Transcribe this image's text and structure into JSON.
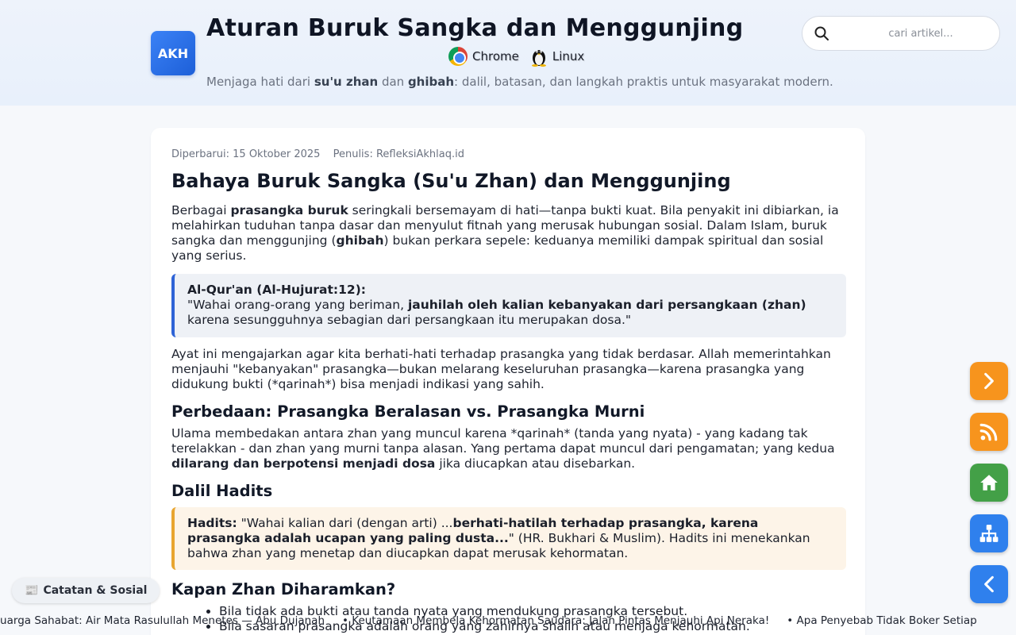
{
  "header": {
    "logo": "AKH",
    "title": "Aturan Buruk Sangka dan Menggunjing",
    "env": {
      "browser": "Chrome",
      "os": "Linux"
    },
    "tagline_parts": [
      "Menjaga hati dari ",
      "su'u zhan",
      " dan ",
      "ghibah",
      ": dalil, batasan, dan langkah praktis untuk masyarakat modern."
    ],
    "search_placeholder": "cari artikel..."
  },
  "article": {
    "updated": "Diperbarui: 15 Oktober 2025",
    "author": "Penulis: RefleksiAkhlaq.id",
    "title": "Bahaya Buruk Sangka (Su'u Zhan) dan Menggunjing",
    "intro_parts": [
      "Berbagai ",
      "prasangka buruk",
      " seringkali bersemayam di hati—tanpa bukti kuat. Bila penyakit ini dibiarkan, ia melahirkan tuduhan tanpa dasar dan menyulut fitnah yang merusak hubungan sosial. Dalam Islam, buruk sangka dan menggunjing (",
      "ghibah",
      ") bukan perkara sepele: keduanya memiliki dampak spiritual dan sosial yang serius."
    ],
    "quran": {
      "source": "Al-Qur'an (Al-Hujurat:12):",
      "text_a": "\"Wahai orang-orang yang beriman, ",
      "text_b": "jauhilah oleh kalian kebanyakan dari persangkaan (zhan)",
      "text_c": " karena sesungguhnya sebagian dari persangkaan itu merupakan dosa.\""
    },
    "paragraph2": "Ayat ini mengajarkan agar kita berhati-hati terhadap prasangka yang tidak berdasar. Allah memerintahkan menjauhi \"kebanyakan\" prasangka—bukan melarang keseluruhan prasangka—karena prasangka yang didukung bukti (*qarinah*) bisa menjadi indikasi yang sahih.",
    "h2_diff": "Perbedaan: Prasangka Beralasan vs. Prasangka Murni",
    "diff_a": "Ulama membedakan antara zhan yang muncul karena *qarinah* (tanda yang nyata) - yang kadang tak terelakkan - dan zhan yang murni tanpa alasan. Yang pertama dapat muncul dari pengamatan; yang kedua ",
    "diff_b": "dilarang dan berpotensi menjadi dosa",
    "diff_c": " jika diucapkan atau disebarkan.",
    "h2_hadith": "Dalil Hadits",
    "hadith": {
      "label": "Hadits:",
      "text_a": " \"Wahai kalian dari (dengan arti) ...",
      "text_b": "berhati-hatilah terhadap prasangka, karena prasangka adalah ucapan yang paling dusta...",
      "text_c": "\" (HR. Bukhari & Muslim). Hadits ini menekankan bahwa zhan yang menetap dan diucapkan dapat merusak kehormatan."
    },
    "h2_when": "Kapan Zhan Diharamkan?",
    "when_items": [
      "Bila tidak ada bukti atau tanda nyata yang mendukung prasangka tersebut.",
      "Bila sasaran prasangka adalah orang yang zahirnya shalih atau menjaga kehormatan."
    ]
  },
  "side_nav": {
    "colors": {
      "next": "#f7941d",
      "rss": "#f7941d",
      "home": "#43a047",
      "sitemap": "#2f80ed",
      "prev": "#2f80ed"
    },
    "icons": [
      "chevron-right-icon",
      "rss-icon",
      "home-icon",
      "sitemap-icon",
      "chevron-left-icon"
    ]
  },
  "category_pill": {
    "icon": "📰",
    "label": "Catatan & Sosial"
  },
  "ticker": [
    "eluarga Sahabat: Air Mata Rasulullah Menetes — Abu Dujanah",
    "Keutamaan Membela Kehormatan Saudara: Jalan Pintas Menjauhi Api Neraka!",
    "Apa Penyebab Tidak Boker Setiap"
  ]
}
